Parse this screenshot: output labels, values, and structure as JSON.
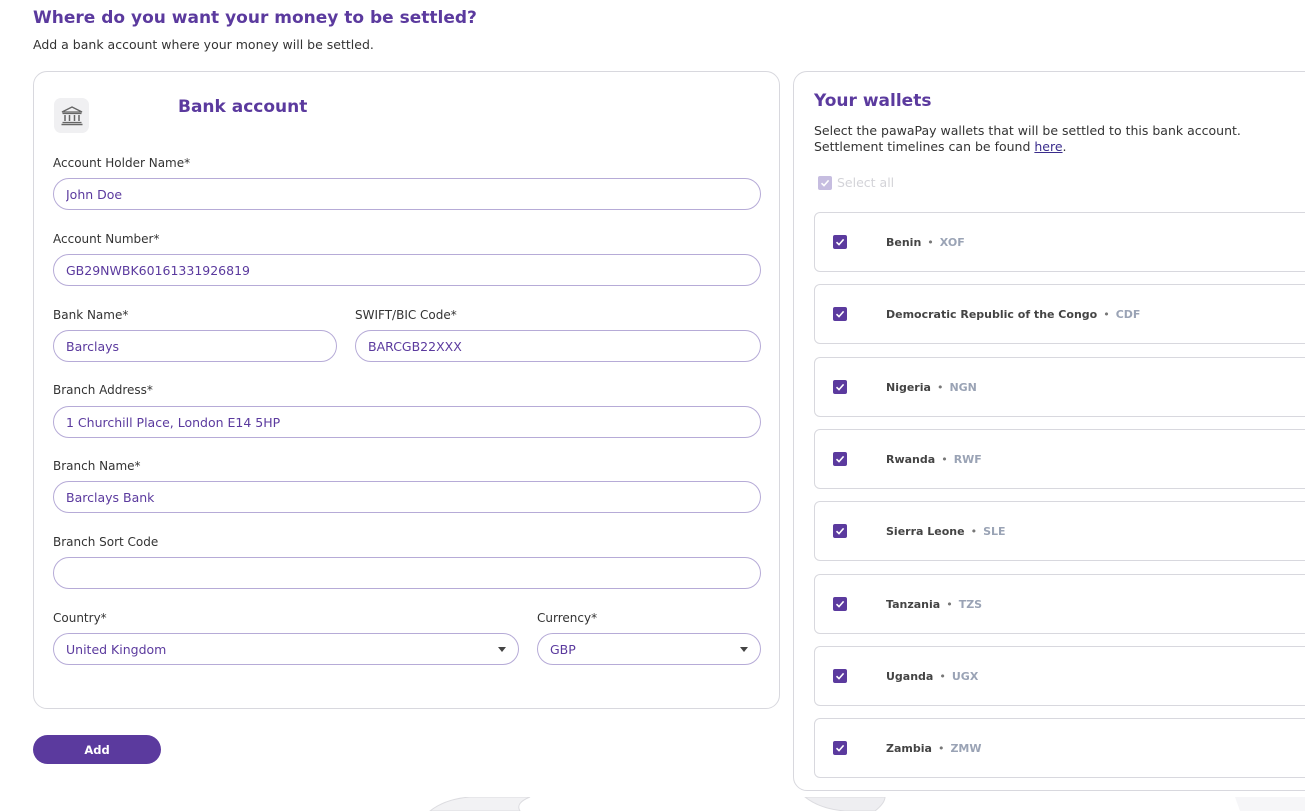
{
  "header": {
    "title": "Where do you want your money to be settled?",
    "subtitle": "Add a bank account where your money will be settled."
  },
  "bank_form": {
    "title": "Bank account",
    "icon": "bank-icon",
    "account_holder": {
      "label": "Account Holder Name*",
      "value": "John Doe"
    },
    "account_number": {
      "label": "Account Number*",
      "value": "GB29NWBK60161331926819"
    },
    "bank_name": {
      "label": "Bank Name*",
      "value": "Barclays"
    },
    "swift": {
      "label": "SWIFT/BIC Code*",
      "value": "BARCGB22XXX"
    },
    "branch_address": {
      "label": "Branch Address*",
      "value": "1 Churchill Place, London E14 5HP"
    },
    "branch_name": {
      "label": "Branch Name*",
      "value": "Barclays Bank"
    },
    "sort_code": {
      "label": "Branch Sort Code",
      "value": ""
    },
    "country": {
      "label": "Country*",
      "value": "United Kingdom"
    },
    "currency": {
      "label": "Currency*",
      "value": "GBP"
    },
    "add_label": "Add"
  },
  "wallets": {
    "title": "Your wallets",
    "desc_line1": "Select the pawaPay wallets that will be settled to this bank account.",
    "desc_line2": "Settlement timelines can be found ",
    "link_text": "here",
    "select_all": "Select all",
    "items": [
      {
        "country": "Benin",
        "currency": "XOF",
        "checked": true
      },
      {
        "country": "Democratic Republic of the Congo",
        "currency": "CDF",
        "checked": true
      },
      {
        "country": "Nigeria",
        "currency": "NGN",
        "checked": true
      },
      {
        "country": "Rwanda",
        "currency": "RWF",
        "checked": true
      },
      {
        "country": "Sierra Leone",
        "currency": "SLE",
        "checked": true
      },
      {
        "country": "Tanzania",
        "currency": "TZS",
        "checked": true
      },
      {
        "country": "Uganda",
        "currency": "UGX",
        "checked": true
      },
      {
        "country": "Zambia",
        "currency": "ZMW",
        "checked": true
      }
    ]
  },
  "colors": {
    "accent": "#5b3a9e",
    "border": "#d8d8de",
    "input_border": "#b6abd7",
    "currency_text": "#9aa3b5"
  }
}
